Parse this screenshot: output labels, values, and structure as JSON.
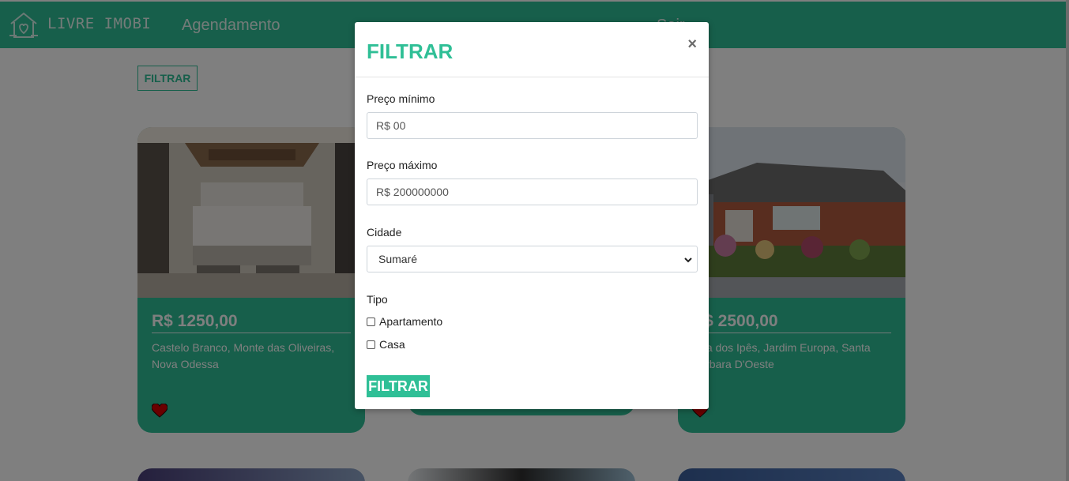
{
  "navbar": {
    "brand": "LIVRE IMOBI",
    "link_schedule": "Agendamento",
    "link_right": "Sair",
    "logo_icon": "house-heart-icon"
  },
  "page": {
    "filter_button": "FILTRAR"
  },
  "listings": [
    {
      "price": "R$ 1250,00",
      "address": "Castelo Branco, Monte das Oliveiras, Nova Odessa",
      "favorite": true
    },
    {
      "price": "",
      "address": "",
      "favorite": false
    },
    {
      "price": "R$ 2500,00",
      "address": "Rua dos Ipês, Jardim Europa, Santa Bárbara D'Oeste",
      "favorite": true
    }
  ],
  "modal": {
    "title": "FILTRAR",
    "close_label": "×",
    "min_price_label": "Preço mínimo",
    "min_price_placeholder": "R$ 00",
    "max_price_label": "Preço máximo",
    "max_price_placeholder": "R$ 200000000",
    "city_label": "Cidade",
    "city_selected": "Sumaré",
    "type_label": "Tipo",
    "type_options": [
      "Apartamento",
      "Casa"
    ],
    "submit_label": "FILTRAR"
  },
  "colors": {
    "brand": "#2fbf96",
    "heart": "#d40000"
  }
}
